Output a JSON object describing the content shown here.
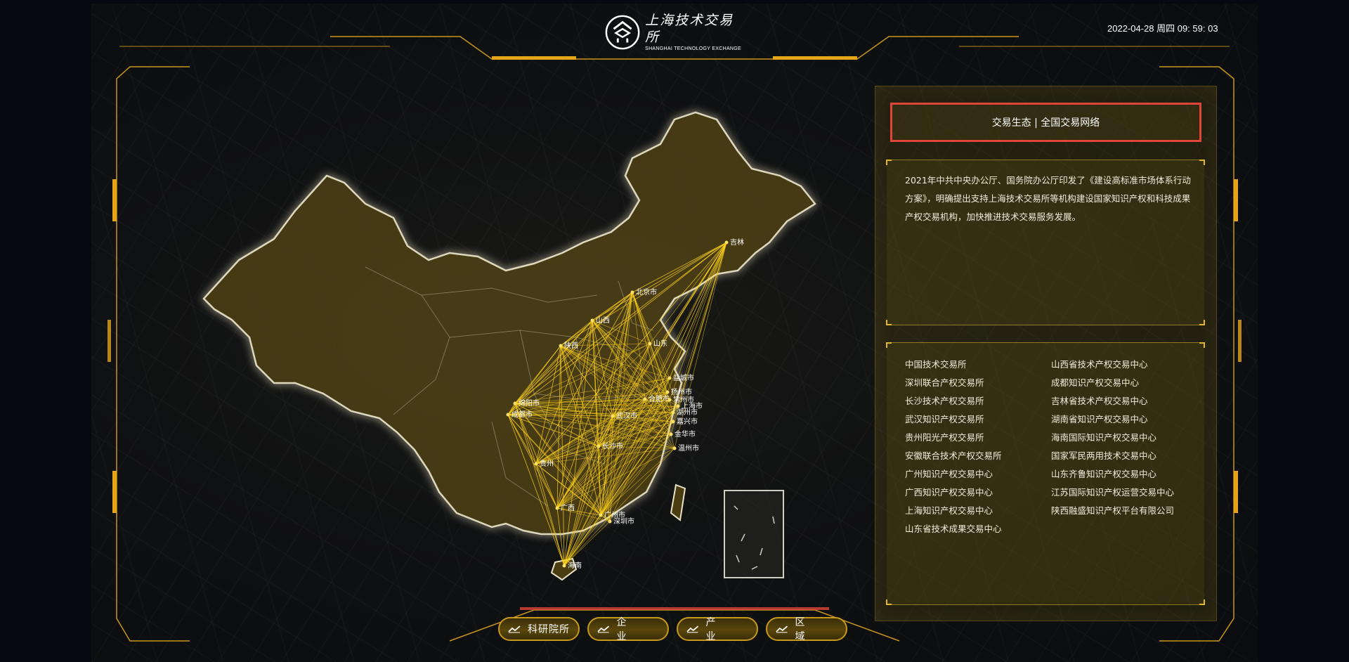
{
  "header": {
    "logo_cn": "上海技术交易所",
    "logo_en": "SHANGHAI TECHNOLOGY EXCHANGE",
    "datetime": "2022-04-28 周四 09: 59: 03"
  },
  "panel": {
    "title": "交易生态 | 全国交易网络",
    "intro": "2021年中共中央办公厅、国务院办公厅印发了《建设高标准市场体系行动方案》，明确提出支持上海技术交易所等机构建设国家知识产权和科技成果产权交易机构，加快推进技术交易服务发展。",
    "exchanges": [
      "中国技术交易所",
      "山西省技术产权交易中心",
      "深圳联合产权交易所",
      "成都知识产权交易中心",
      "长沙技术产权交易所",
      "吉林省技术产权交易中心",
      "武汉知识产权交易所",
      "湖南省知识产权交易中心",
      "贵州阳光产权交易所",
      "海南国际知识产权交易中心",
      "安徽联合技术产权交易所",
      "国家军民两用技术交易中心",
      "广州知识产权交易中心",
      "山东齐鲁知识产权交易中心",
      "广西知识产权交易中心",
      "江苏国际知识产权运营交易中心",
      "上海知识产权交易中心",
      "陕西融盛知识产权平台有限公司",
      "山东省技术成果交易中心"
    ]
  },
  "map": {
    "cities": [
      "吉林",
      "北京市",
      "山西",
      "山东",
      "陕西",
      "盐城市",
      "扬州市",
      "合肥市",
      "常州市",
      "上海市",
      "湖州市",
      "嘉兴市",
      "武汉市",
      "绵阳市",
      "成都市",
      "长沙市",
      "金华市",
      "温州市",
      "贵州",
      "广西",
      "广州市",
      "深圳市",
      "海南"
    ]
  },
  "nav": {
    "items": [
      {
        "label": "科研院所"
      },
      {
        "label": "企 业"
      },
      {
        "label": "产 业"
      },
      {
        "label": "区 域"
      }
    ]
  },
  "colors": {
    "accent": "#e6b820",
    "frame": "#c9961a",
    "title_border": "#e0453a",
    "map_fill": "#4a3d12",
    "route": "#ffd21a"
  }
}
